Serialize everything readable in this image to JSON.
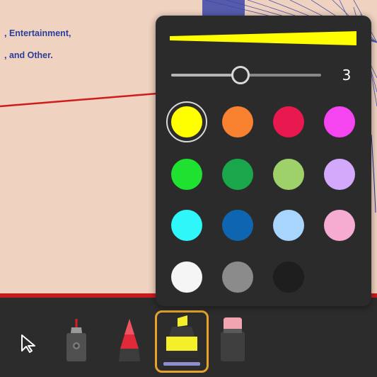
{
  "document": {
    "line1": ", Entertainment,",
    "line2": ", and Other."
  },
  "popover": {
    "stroke_size": "3",
    "slider_level_fraction": 0.46,
    "swatches": [
      {
        "name": "yellow",
        "color": "#ffff00",
        "selected": true
      },
      {
        "name": "orange",
        "color": "#f98231",
        "selected": false
      },
      {
        "name": "crimson",
        "color": "#e9184e",
        "selected": false
      },
      {
        "name": "magenta",
        "color": "#f545f1",
        "selected": false
      },
      {
        "name": "green",
        "color": "#1fe130",
        "selected": false
      },
      {
        "name": "dark-green",
        "color": "#1aa74b",
        "selected": false
      },
      {
        "name": "light-green",
        "color": "#9fd16a",
        "selected": false
      },
      {
        "name": "lavender",
        "color": "#d4a8fb",
        "selected": false
      },
      {
        "name": "cyan",
        "color": "#2ef6f9",
        "selected": false
      },
      {
        "name": "blue",
        "color": "#0f66b0",
        "selected": false
      },
      {
        "name": "light-blue",
        "color": "#a8d5fb",
        "selected": false
      },
      {
        "name": "pink",
        "color": "#f6abd0",
        "selected": false
      },
      {
        "name": "white",
        "color": "#f5f5f5",
        "selected": false
      },
      {
        "name": "gray",
        "color": "#8b8b8b",
        "selected": false
      },
      {
        "name": "black",
        "color": "#1e1e1e",
        "selected": false
      }
    ]
  },
  "colors": {
    "accent": "#e7a22c",
    "preview_stroke": "#ffff00"
  },
  "toolbar": {
    "tools": [
      "select-tool",
      "pen-tool",
      "marker-tool",
      "highlighter-tool",
      "eraser-tool"
    ],
    "active_tool": "highlighter-tool"
  }
}
